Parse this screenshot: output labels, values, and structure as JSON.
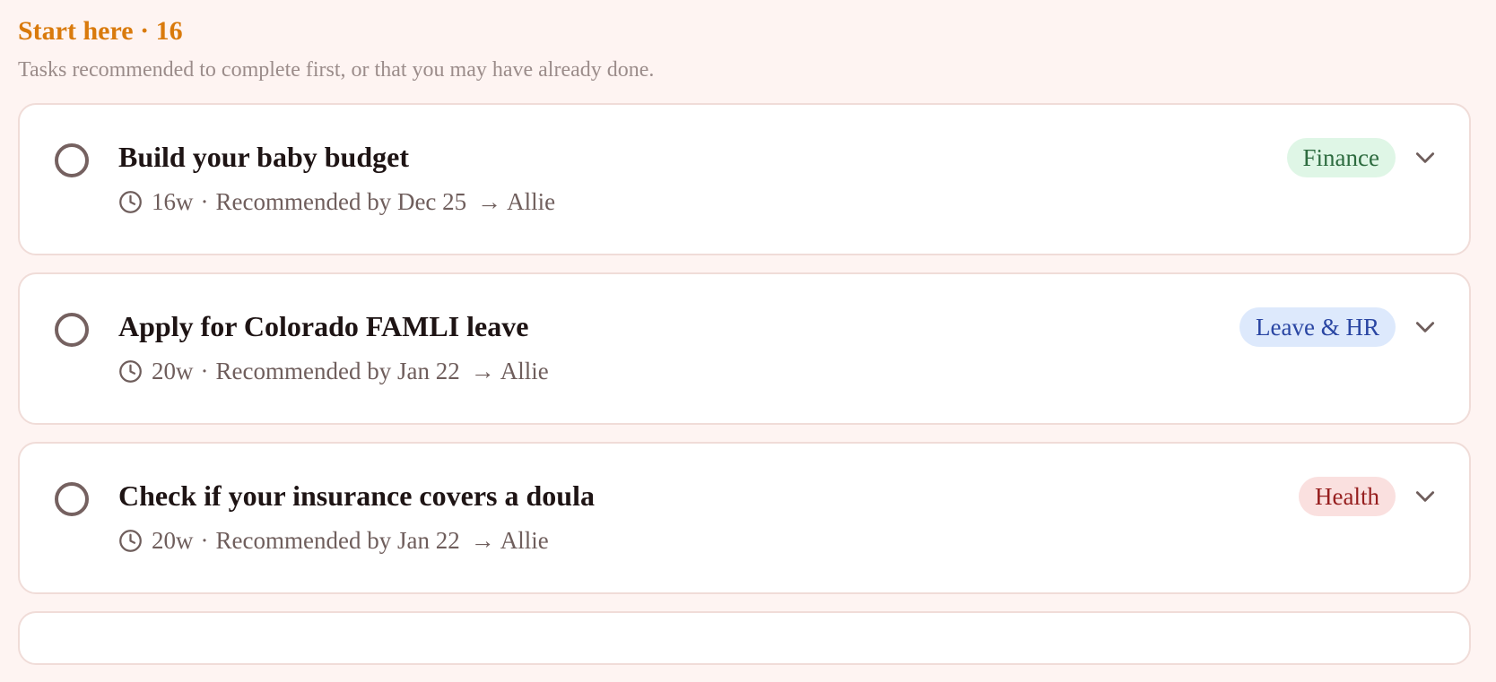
{
  "section": {
    "title": "Start here · 16",
    "subtitle": "Tasks recommended to complete first, or that you may have already done."
  },
  "colors": {
    "background": "#fef4f2",
    "section_title": "#d97a0c",
    "finance_badge_bg": "#dff6e6",
    "finance_badge_text": "#2d6b3f",
    "leave_badge_bg": "#dde9fc",
    "leave_badge_text": "#2a46a3",
    "health_badge_bg": "#fae0df",
    "health_badge_text": "#961e1e"
  },
  "tasks": [
    {
      "title": "Build your baby budget",
      "week": "16w",
      "recommended": "Recommended by Dec 25",
      "assignee": "Allie",
      "category": "Finance",
      "icon": "clock-icon"
    },
    {
      "title": "Apply for Colorado FAMLI leave",
      "week": "20w",
      "recommended": "Recommended by Jan 22",
      "assignee": "Allie",
      "category": "Leave & HR",
      "icon": "clock-icon"
    },
    {
      "title": "Check if your insurance covers a doula",
      "week": "20w",
      "recommended": "Recommended by Jan 22",
      "assignee": "Allie",
      "category": "Health",
      "icon": "clock-icon"
    }
  ],
  "meta": {
    "separator": "·",
    "arrow": "→"
  }
}
